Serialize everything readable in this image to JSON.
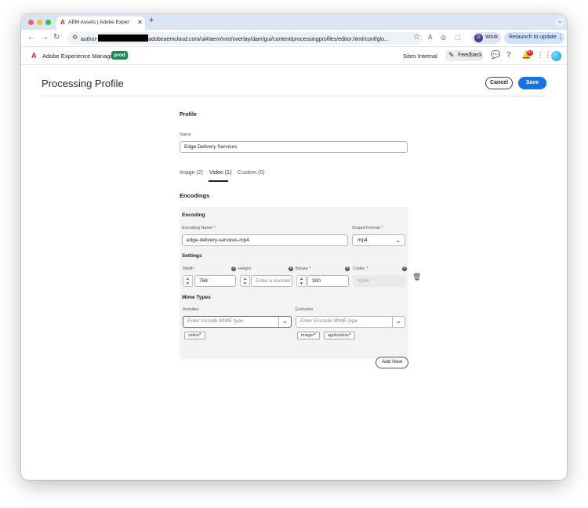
{
  "browser": {
    "tab": {
      "title": "AEM Assets | Adobe Experien",
      "close": "✕"
    },
    "new_tab": "+",
    "omnibox": {
      "url_prefix": "author-",
      "url_suffix": "adobeaemcloud.com/ui#/aem/mnt/overlay/dam/gui/content/processingprofiles/editor.html/conf/glo..."
    },
    "profile_chip": {
      "initial": "D",
      "label": "Work"
    },
    "relaunch_label": "Relaunch to update",
    "traffic_colors": {
      "close": "#ff5f57",
      "minimize": "#febc2e",
      "zoom": "#28c840"
    }
  },
  "app_header": {
    "app_name": "Adobe Experience Manager",
    "env_badge": "prod",
    "sites_label": "Sites Internal",
    "feedback_label": "Feedback",
    "notification_count": "9+"
  },
  "page": {
    "title": "Processing Profile",
    "cancel_label": "Cancel",
    "save_label": "Save"
  },
  "form": {
    "profile_heading": "Profile",
    "name_label": "Name",
    "name_value": "Edge Delivery Services",
    "tabs": [
      {
        "label": "Image (2)",
        "active": false
      },
      {
        "label": "Video (1)",
        "active": true
      },
      {
        "label": "Custom (0)",
        "active": false
      }
    ],
    "encodings_heading": "Encodings",
    "encoding": {
      "heading": "Encoding",
      "name_label": "Encoding Name *",
      "name_value": "edge-delivery-services-mp4",
      "output_format_label": "Output Format *",
      "output_format_value": "mp4",
      "settings_heading": "Settings",
      "width_label": "Width",
      "width_value": "768",
      "height_label": "Height",
      "height_placeholder": "Enter a number",
      "bitrate_label": "Bitrate *",
      "bitrate_value": "300",
      "codec_label": "Codec *",
      "codec_value": "h264",
      "mime_heading": "Mime Types",
      "includes_label": "Includes",
      "includes_placeholder": "Enter Include MIME type",
      "includes_tags": [
        "video/*"
      ],
      "excludes_label": "Excludes",
      "excludes_placeholder": "Enter Exclude MIME type",
      "excludes_tags": [
        "image/*",
        "application/*"
      ]
    },
    "add_new_label": "Add New"
  },
  "colors": {
    "accent": "#1473e6",
    "env_badge": "#1a8a5a",
    "adobe_red": "#e0201b"
  },
  "icons": {
    "back": "back-arrow-icon",
    "forward": "forward-arrow-icon",
    "reload": "reload-icon",
    "bookmark": "star-icon",
    "delete": "trash-icon",
    "dropdown": "chevron-down-icon",
    "info": "info-icon",
    "help": "help-icon",
    "apps": "apps-grid-icon",
    "bell": "bell-icon"
  }
}
